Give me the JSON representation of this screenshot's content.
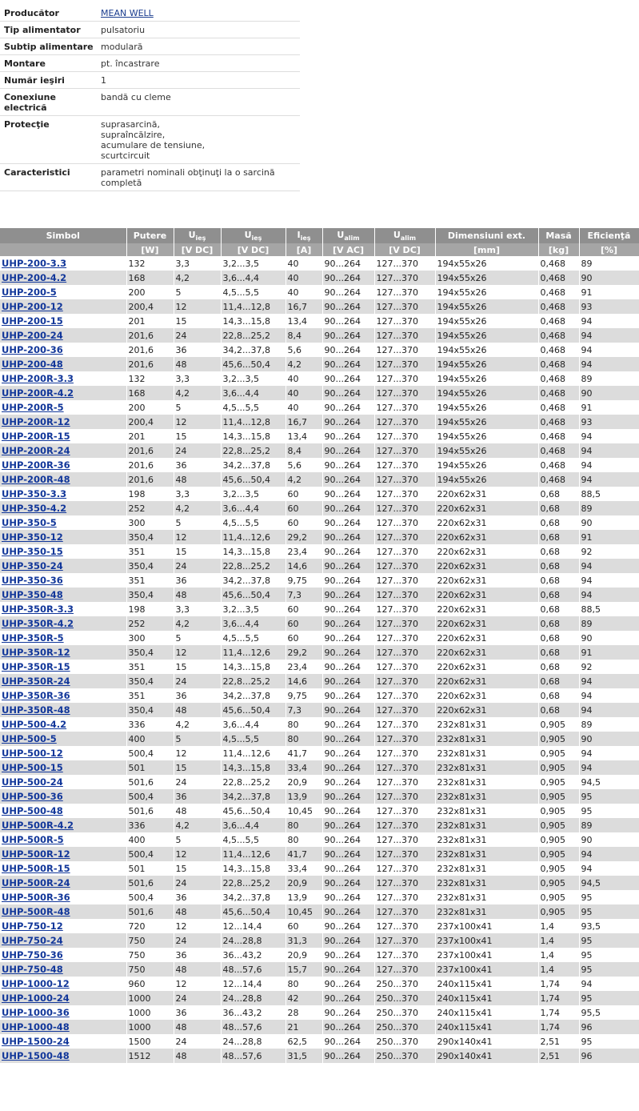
{
  "props": [
    {
      "label": "Producător",
      "value": "MEAN WELL",
      "link": true
    },
    {
      "label": "Tip alimentator",
      "value": "pulsatoriu"
    },
    {
      "label": "Subtip alimentare",
      "value": "modulară"
    },
    {
      "label": "Montare",
      "value": "pt. încastrare"
    },
    {
      "label": "Număr ieşiri",
      "value": "1"
    },
    {
      "label": "Conexiune electrică",
      "value": "bandă cu cleme"
    },
    {
      "label": "Protecţie",
      "value": "suprasarcină,\nsupraîncălzire,\nacumulare de tensiune,\nscurtcircuit"
    },
    {
      "label": "Caracteristici",
      "value": "parametri nominali obţinuţi la o sarcină completă"
    }
  ],
  "columns": [
    {
      "name": "Simbol",
      "sub": "",
      "unit": ""
    },
    {
      "name": "Putere",
      "sub": "",
      "unit": "[W]"
    },
    {
      "name": "U",
      "sub": "ieş",
      "unit": "[V DC]"
    },
    {
      "name": "U",
      "sub": "ieş",
      "unit": "[V DC]"
    },
    {
      "name": "I",
      "sub": "ieş",
      "unit": "[A]"
    },
    {
      "name": "U",
      "sub": "alim",
      "unit": "[V AC]"
    },
    {
      "name": "U",
      "sub": "alim",
      "unit": "[V DC]"
    },
    {
      "name": "Dimensiuni ext.",
      "sub": "",
      "unit": "[mm]"
    },
    {
      "name": "Masă",
      "sub": "",
      "unit": "[kg]"
    },
    {
      "name": "Eficienţă",
      "sub": "",
      "unit": "[%]"
    }
  ],
  "rows": [
    [
      "UHP-200-3.3",
      "132",
      "3,3",
      "3,2...3,5",
      "40",
      "90...264",
      "127...370",
      "194x55x26",
      "0,468",
      "89"
    ],
    [
      "UHP-200-4.2",
      "168",
      "4,2",
      "3,6...4,4",
      "40",
      "90...264",
      "127...370",
      "194x55x26",
      "0,468",
      "90"
    ],
    [
      "UHP-200-5",
      "200",
      "5",
      "4,5...5,5",
      "40",
      "90...264",
      "127...370",
      "194x55x26",
      "0,468",
      "91"
    ],
    [
      "UHP-200-12",
      "200,4",
      "12",
      "11,4...12,8",
      "16,7",
      "90...264",
      "127...370",
      "194x55x26",
      "0,468",
      "93"
    ],
    [
      "UHP-200-15",
      "201",
      "15",
      "14,3...15,8",
      "13,4",
      "90...264",
      "127...370",
      "194x55x26",
      "0,468",
      "94"
    ],
    [
      "UHP-200-24",
      "201,6",
      "24",
      "22,8...25,2",
      "8,4",
      "90...264",
      "127...370",
      "194x55x26",
      "0,468",
      "94"
    ],
    [
      "UHP-200-36",
      "201,6",
      "36",
      "34,2...37,8",
      "5,6",
      "90...264",
      "127...370",
      "194x55x26",
      "0,468",
      "94"
    ],
    [
      "UHP-200-48",
      "201,6",
      "48",
      "45,6...50,4",
      "4,2",
      "90...264",
      "127...370",
      "194x55x26",
      "0,468",
      "94"
    ],
    [
      "UHP-200R-3.3",
      "132",
      "3,3",
      "3,2...3,5",
      "40",
      "90...264",
      "127...370",
      "194x55x26",
      "0,468",
      "89"
    ],
    [
      "UHP-200R-4.2",
      "168",
      "4,2",
      "3,6...4,4",
      "40",
      "90...264",
      "127...370",
      "194x55x26",
      "0,468",
      "90"
    ],
    [
      "UHP-200R-5",
      "200",
      "5",
      "4,5...5,5",
      "40",
      "90...264",
      "127...370",
      "194x55x26",
      "0,468",
      "91"
    ],
    [
      "UHP-200R-12",
      "200,4",
      "12",
      "11,4...12,8",
      "16,7",
      "90...264",
      "127...370",
      "194x55x26",
      "0,468",
      "93"
    ],
    [
      "UHP-200R-15",
      "201",
      "15",
      "14,3...15,8",
      "13,4",
      "90...264",
      "127...370",
      "194x55x26",
      "0,468",
      "94"
    ],
    [
      "UHP-200R-24",
      "201,6",
      "24",
      "22,8...25,2",
      "8,4",
      "90...264",
      "127...370",
      "194x55x26",
      "0,468",
      "94"
    ],
    [
      "UHP-200R-36",
      "201,6",
      "36",
      "34,2...37,8",
      "5,6",
      "90...264",
      "127...370",
      "194x55x26",
      "0,468",
      "94"
    ],
    [
      "UHP-200R-48",
      "201,6",
      "48",
      "45,6...50,4",
      "4,2",
      "90...264",
      "127...370",
      "194x55x26",
      "0,468",
      "94"
    ],
    [
      "UHP-350-3.3",
      "198",
      "3,3",
      "3,2...3,5",
      "60",
      "90...264",
      "127...370",
      "220x62x31",
      "0,68",
      "88,5"
    ],
    [
      "UHP-350-4.2",
      "252",
      "4,2",
      "3,6...4,4",
      "60",
      "90...264",
      "127...370",
      "220x62x31",
      "0,68",
      "89"
    ],
    [
      "UHP-350-5",
      "300",
      "5",
      "4,5...5,5",
      "60",
      "90...264",
      "127...370",
      "220x62x31",
      "0,68",
      "90"
    ],
    [
      "UHP-350-12",
      "350,4",
      "12",
      "11,4...12,6",
      "29,2",
      "90...264",
      "127...370",
      "220x62x31",
      "0,68",
      "91"
    ],
    [
      "UHP-350-15",
      "351",
      "15",
      "14,3...15,8",
      "23,4",
      "90...264",
      "127...370",
      "220x62x31",
      "0,68",
      "92"
    ],
    [
      "UHP-350-24",
      "350,4",
      "24",
      "22,8...25,2",
      "14,6",
      "90...264",
      "127...370",
      "220x62x31",
      "0,68",
      "94"
    ],
    [
      "UHP-350-36",
      "351",
      "36",
      "34,2...37,8",
      "9,75",
      "90...264",
      "127...370",
      "220x62x31",
      "0,68",
      "94"
    ],
    [
      "UHP-350-48",
      "350,4",
      "48",
      "45,6...50,4",
      "7,3",
      "90...264",
      "127...370",
      "220x62x31",
      "0,68",
      "94"
    ],
    [
      "UHP-350R-3.3",
      "198",
      "3,3",
      "3,2...3,5",
      "60",
      "90...264",
      "127...370",
      "220x62x31",
      "0,68",
      "88,5"
    ],
    [
      "UHP-350R-4.2",
      "252",
      "4,2",
      "3,6...4,4",
      "60",
      "90...264",
      "127...370",
      "220x62x31",
      "0,68",
      "89"
    ],
    [
      "UHP-350R-5",
      "300",
      "5",
      "4,5...5,5",
      "60",
      "90...264",
      "127...370",
      "220x62x31",
      "0,68",
      "90"
    ],
    [
      "UHP-350R-12",
      "350,4",
      "12",
      "11,4...12,6",
      "29,2",
      "90...264",
      "127...370",
      "220x62x31",
      "0,68",
      "91"
    ],
    [
      "UHP-350R-15",
      "351",
      "15",
      "14,3...15,8",
      "23,4",
      "90...264",
      "127...370",
      "220x62x31",
      "0,68",
      "92"
    ],
    [
      "UHP-350R-24",
      "350,4",
      "24",
      "22,8...25,2",
      "14,6",
      "90...264",
      "127...370",
      "220x62x31",
      "0,68",
      "94"
    ],
    [
      "UHP-350R-36",
      "351",
      "36",
      "34,2...37,8",
      "9,75",
      "90...264",
      "127...370",
      "220x62x31",
      "0,68",
      "94"
    ],
    [
      "UHP-350R-48",
      "350,4",
      "48",
      "45,6...50,4",
      "7,3",
      "90...264",
      "127...370",
      "220x62x31",
      "0,68",
      "94"
    ],
    [
      "UHP-500-4.2",
      "336",
      "4,2",
      "3,6...4,4",
      "80",
      "90...264",
      "127...370",
      "232x81x31",
      "0,905",
      "89"
    ],
    [
      "UHP-500-5",
      "400",
      "5",
      "4,5...5,5",
      "80",
      "90...264",
      "127...370",
      "232x81x31",
      "0,905",
      "90"
    ],
    [
      "UHP-500-12",
      "500,4",
      "12",
      "11,4...12,6",
      "41,7",
      "90...264",
      "127...370",
      "232x81x31",
      "0,905",
      "94"
    ],
    [
      "UHP-500-15",
      "501",
      "15",
      "14,3...15,8",
      "33,4",
      "90...264",
      "127...370",
      "232x81x31",
      "0,905",
      "94"
    ],
    [
      "UHP-500-24",
      "501,6",
      "24",
      "22,8...25,2",
      "20,9",
      "90...264",
      "127...370",
      "232x81x31",
      "0,905",
      "94,5"
    ],
    [
      "UHP-500-36",
      "500,4",
      "36",
      "34,2...37,8",
      "13,9",
      "90...264",
      "127...370",
      "232x81x31",
      "0,905",
      "95"
    ],
    [
      "UHP-500-48",
      "501,6",
      "48",
      "45,6...50,4",
      "10,45",
      "90...264",
      "127...370",
      "232x81x31",
      "0,905",
      "95"
    ],
    [
      "UHP-500R-4.2",
      "336",
      "4,2",
      "3,6...4,4",
      "80",
      "90...264",
      "127...370",
      "232x81x31",
      "0,905",
      "89"
    ],
    [
      "UHP-500R-5",
      "400",
      "5",
      "4,5...5,5",
      "80",
      "90...264",
      "127...370",
      "232x81x31",
      "0,905",
      "90"
    ],
    [
      "UHP-500R-12",
      "500,4",
      "12",
      "11,4...12,6",
      "41,7",
      "90...264",
      "127...370",
      "232x81x31",
      "0,905",
      "94"
    ],
    [
      "UHP-500R-15",
      "501",
      "15",
      "14,3...15,8",
      "33,4",
      "90...264",
      "127...370",
      "232x81x31",
      "0,905",
      "94"
    ],
    [
      "UHP-500R-24",
      "501,6",
      "24",
      "22,8...25,2",
      "20,9",
      "90...264",
      "127...370",
      "232x81x31",
      "0,905",
      "94,5"
    ],
    [
      "UHP-500R-36",
      "500,4",
      "36",
      "34,2...37,8",
      "13,9",
      "90...264",
      "127...370",
      "232x81x31",
      "0,905",
      "95"
    ],
    [
      "UHP-500R-48",
      "501,6",
      "48",
      "45,6...50,4",
      "10,45",
      "90...264",
      "127...370",
      "232x81x31",
      "0,905",
      "95"
    ],
    [
      "UHP-750-12",
      "720",
      "12",
      "12...14,4",
      "60",
      "90...264",
      "127...370",
      "237x100x41",
      "1,4",
      "93,5"
    ],
    [
      "UHP-750-24",
      "750",
      "24",
      "24...28,8",
      "31,3",
      "90...264",
      "127...370",
      "237x100x41",
      "1,4",
      "95"
    ],
    [
      "UHP-750-36",
      "750",
      "36",
      "36...43,2",
      "20,9",
      "90...264",
      "127...370",
      "237x100x41",
      "1,4",
      "95"
    ],
    [
      "UHP-750-48",
      "750",
      "48",
      "48...57,6",
      "15,7",
      "90...264",
      "127...370",
      "237x100x41",
      "1,4",
      "95"
    ],
    [
      "UHP-1000-12",
      "960",
      "12",
      "12...14,4",
      "80",
      "90...264",
      "250...370",
      "240x115x41",
      "1,74",
      "94"
    ],
    [
      "UHP-1000-24",
      "1000",
      "24",
      "24...28,8",
      "42",
      "90...264",
      "250...370",
      "240x115x41",
      "1,74",
      "95"
    ],
    [
      "UHP-1000-36",
      "1000",
      "36",
      "36...43,2",
      "28",
      "90...264",
      "250...370",
      "240x115x41",
      "1,74",
      "95,5"
    ],
    [
      "UHP-1000-48",
      "1000",
      "48",
      "48...57,6",
      "21",
      "90...264",
      "250...370",
      "240x115x41",
      "1,74",
      "96"
    ],
    [
      "UHP-1500-24",
      "1500",
      "24",
      "24...28,8",
      "62,5",
      "90...264",
      "250...370",
      "290x140x41",
      "2,51",
      "95"
    ],
    [
      "UHP-1500-48",
      "1512",
      "48",
      "48...57,6",
      "31,5",
      "90...264",
      "250...370",
      "290x140x41",
      "2,51",
      "96"
    ]
  ],
  "colors": {
    "header": "#8f8f8f",
    "subheader": "#a5a5a5",
    "stripe": "#dcdcdc",
    "link": "#12379a"
  }
}
